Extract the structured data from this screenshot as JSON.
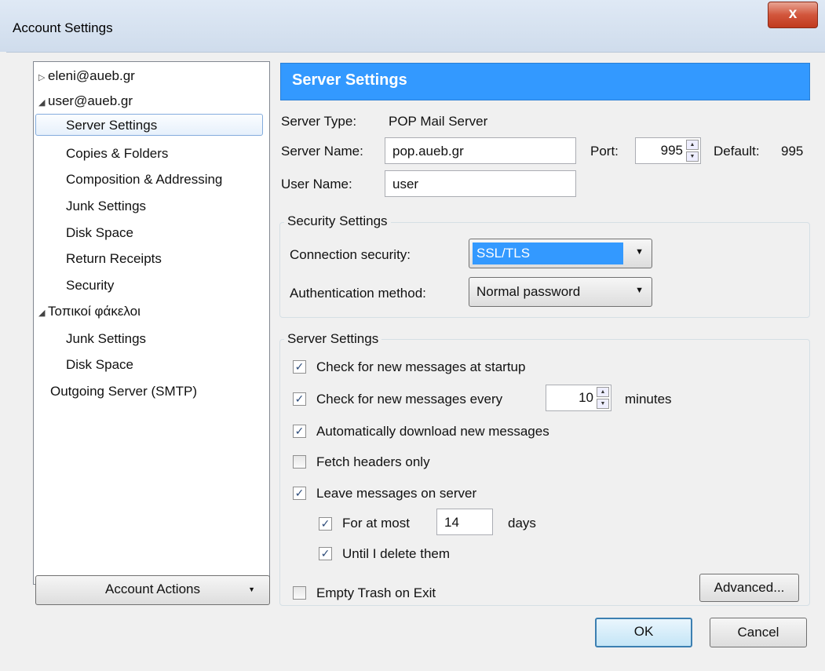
{
  "window": {
    "title": "Account Settings",
    "close_label": "x"
  },
  "tree": [
    {
      "label": "eleni@aueb.gr",
      "twisty": "▷"
    },
    {
      "label": "user@aueb.gr",
      "twisty": "◢"
    },
    {
      "label": "Server Settings"
    },
    {
      "label": "Copies & Folders"
    },
    {
      "label": "Composition & Addressing"
    },
    {
      "label": "Junk Settings"
    },
    {
      "label": "Disk Space"
    },
    {
      "label": "Return Receipts"
    },
    {
      "label": "Security"
    },
    {
      "label": "Τοπικοί φάκελοι",
      "twisty": "◢"
    },
    {
      "label": "Junk Settings"
    },
    {
      "label": "Disk Space"
    },
    {
      "label": "Outgoing Server (SMTP)"
    }
  ],
  "account_actions": {
    "label": "Account Actions",
    "arrow": "▼"
  },
  "header": {
    "title": "Server Settings"
  },
  "server": {
    "type_label": "Server Type:",
    "type_value": "POP Mail Server",
    "name_label": "Server Name:",
    "name_value": "pop.aueb.gr",
    "port_label": "Port:",
    "port_value": "995",
    "default_label": "Default:",
    "default_value": "995",
    "user_label": "User Name:",
    "user_value": "user"
  },
  "security": {
    "title": "Security Settings",
    "connection_label": "Connection security:",
    "connection_value": "SSL/TLS",
    "auth_label": "Authentication method:",
    "auth_value": "Normal password"
  },
  "server_settings": {
    "title": "Server Settings",
    "check_startup": {
      "label": "Check for new messages at startup",
      "checked": true
    },
    "check_every": {
      "label": "Check for new messages every",
      "checked": true,
      "value": "10",
      "unit": "minutes"
    },
    "auto_download": {
      "label": "Automatically download new messages",
      "checked": true
    },
    "fetch_headers": {
      "label": "Fetch headers only",
      "checked": false
    },
    "leave_on_server": {
      "label": "Leave messages on server",
      "checked": true
    },
    "for_at_most": {
      "label": "For at most",
      "checked": true,
      "value": "14",
      "unit": "days"
    },
    "until_delete": {
      "label": "Until I delete them",
      "checked": true
    },
    "empty_trash": {
      "label": "Empty Trash on Exit",
      "checked": false
    },
    "advanced_label": "Advanced..."
  },
  "buttons": {
    "ok": "OK",
    "cancel": "Cancel"
  }
}
